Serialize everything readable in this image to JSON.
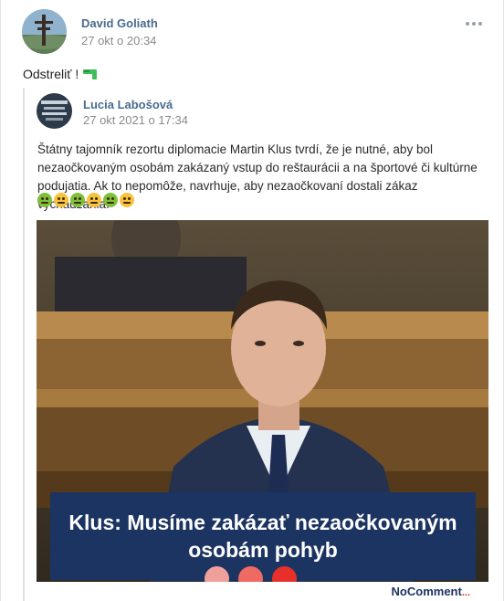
{
  "post": {
    "author": "David Goliath",
    "timestamp": "27 okt o 20:34",
    "text": "Odstreliť !",
    "text_icon": "pistol-icon",
    "menu_icon": "more-horizontal-icon"
  },
  "shared_post": {
    "author": "Lucia Labošová",
    "timestamp": "27 okt 2021 o 17:34",
    "text": "Štátny tajomník rezortu diplomacie Martin Klus tvrdí, že je nutné, aby bol nezaočkovaným osobám zakázaný vstup do reštaurácii a na športové či kultúrne podujatia. Ak to nepomôže, navrhuje, aby nezaočkovaní dostali zákaz vychádzania.",
    "emojis": [
      "nauseated-face-icon",
      "angry-face-icon",
      "nauseated-face-icon",
      "angry-face-icon",
      "nauseated-face-icon",
      "angry-face-icon"
    ]
  },
  "image": {
    "headline_line1": "Klus: Musíme zakázať nezaočkovaným",
    "headline_line2": "osobám pohyb",
    "brand": "NoComment",
    "brand_suffix": "...",
    "dot_colors": [
      "#f0a09a",
      "#ee6a63",
      "#e8302b"
    ],
    "headline_bg": "#1c3461"
  },
  "colors": {
    "author_name": "#4a6b8f",
    "timestamp": "#8a8a8a"
  }
}
